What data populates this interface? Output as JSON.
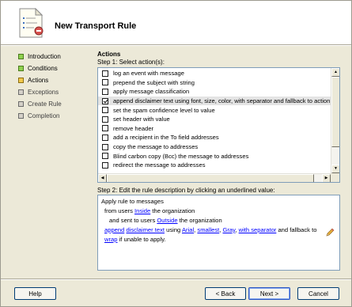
{
  "window": {
    "title": "New Transport Rule"
  },
  "nav": {
    "items": [
      {
        "label": "Introduction",
        "state": "done"
      },
      {
        "label": "Conditions",
        "state": "done"
      },
      {
        "label": "Actions",
        "state": "current"
      },
      {
        "label": "Exceptions",
        "state": "pending"
      },
      {
        "label": "Create Rule",
        "state": "pending"
      },
      {
        "label": "Completion",
        "state": "pending"
      }
    ]
  },
  "main": {
    "section_title": "Actions",
    "step1_label": "Step 1: Select action(s):",
    "actions": [
      {
        "label": "log an event with message",
        "checked": false
      },
      {
        "label": "prepend the subject with string",
        "checked": false
      },
      {
        "label": "apply message classification",
        "checked": false
      },
      {
        "label": "append disclaimer text using font, size, color, with separator and fallback to action i",
        "checked": true
      },
      {
        "label": "set the spam confidence level to value",
        "checked": false
      },
      {
        "label": "set header with value",
        "checked": false
      },
      {
        "label": "remove header",
        "checked": false
      },
      {
        "label": "add a recipient in the To field addresses",
        "checked": false
      },
      {
        "label": "copy the message to addresses",
        "checked": false
      },
      {
        "label": "Blind carbon copy (Bcc) the message to addresses",
        "checked": false
      },
      {
        "label": "redirect the message to addresses",
        "checked": false
      }
    ],
    "step2_label": "Step 2: Edit the rule description by clicking an underlined value:",
    "description": {
      "line1": "Apply rule to messages",
      "line2_pre": "from users ",
      "line2_link": "Inside",
      "line2_post": " the organization",
      "line3_pre": "and sent to users ",
      "line3_link": "Outside",
      "line3_post": " the organization",
      "line4": {
        "append": "append",
        "disclaimer_text": "disclaimer text",
        "using": " using ",
        "font": "Arial",
        "comma1": ", ",
        "size": "smallest",
        "comma2": ", ",
        "color": "Gray",
        "comma3": ", ",
        "separator": "with separator",
        "fallback_text": " and fallback to",
        "wrap": "wrap",
        "tail": " if unable to apply."
      }
    }
  },
  "footer": {
    "help": "Help",
    "back": "< Back",
    "next": "Next >",
    "cancel": "Cancel"
  },
  "colors": {
    "link": "#0000ff",
    "done": "#8fd14f",
    "current": "#f2c84b",
    "background": "#ece9d8"
  }
}
